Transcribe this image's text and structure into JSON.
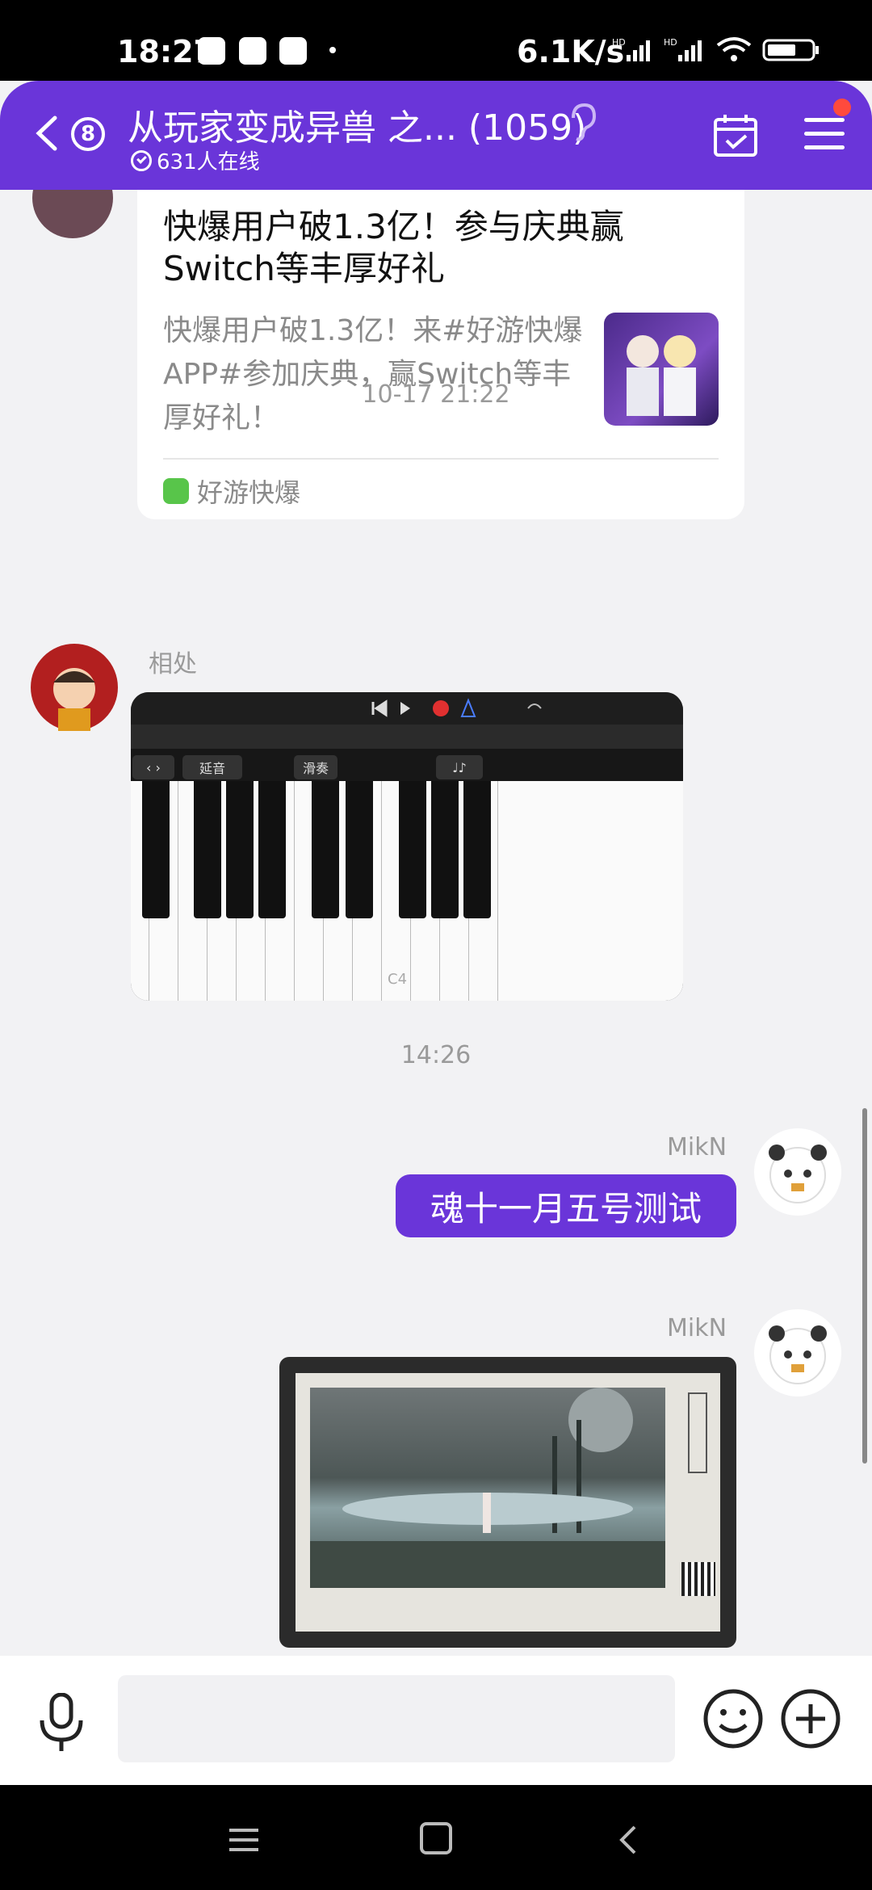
{
  "status_bar": {
    "time": "18:27",
    "net_speed": "6.1K/s"
  },
  "header": {
    "unread_count": "8",
    "title": "从玩家变成异兽 之... (1059)",
    "online": "631人在线"
  },
  "share_card": {
    "title": "快爆用户破1.3亿！参与庆典赢Switch等丰厚好礼",
    "description": "快爆用户破1.3亿！来#好游快爆APP#参加庆典，赢Switch等丰厚好礼！",
    "source": "好游快爆"
  },
  "messages": {
    "timestamp_1": "10-17 21:22",
    "sender_1": "相处",
    "piano_toolbar": {
      "sustain": "延音",
      "glide": "滑奏",
      "note": "C4"
    },
    "timestamp_2": "14:26",
    "sender_2": "MikN",
    "text_message": "魂十一月五号测试",
    "sender_3": "MikN"
  },
  "input": {
    "placeholder": ""
  },
  "colors": {
    "accent": "#6a35d9",
    "badge_red": "#ff4a3d"
  }
}
